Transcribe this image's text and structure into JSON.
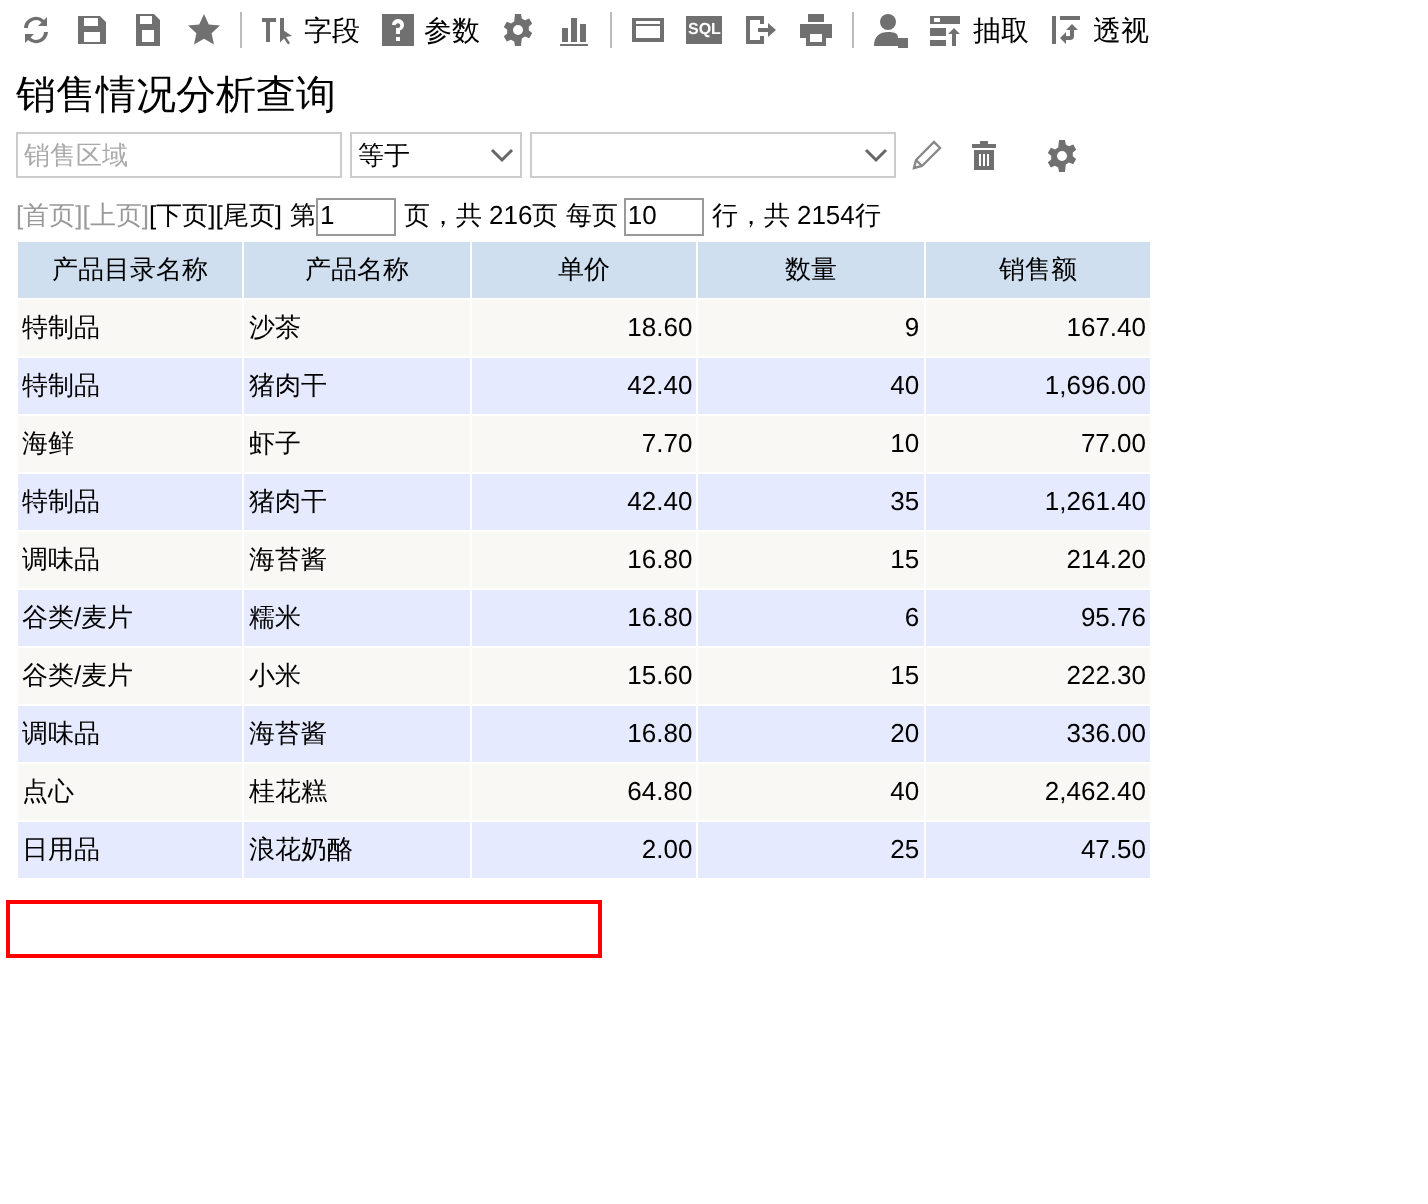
{
  "toolbar": [
    {
      "kind": "icon"
    },
    {
      "kind": "icon"
    },
    {
      "kind": "icon"
    },
    {
      "kind": "icon"
    },
    {
      "kind": "separator"
    },
    {
      "kind": "icon",
      "label": "字段"
    },
    {
      "kind": "icon",
      "label": "参数"
    },
    {
      "kind": "icon"
    },
    {
      "kind": "icon"
    },
    {
      "kind": "separator"
    },
    {
      "kind": "icon"
    },
    {
      "kind": "icon",
      "badge": "SQL"
    },
    {
      "kind": "icon"
    },
    {
      "kind": "icon"
    },
    {
      "kind": "separator"
    },
    {
      "kind": "icon"
    },
    {
      "kind": "icon",
      "label": "抽取"
    },
    {
      "kind": "icon",
      "label": "透视"
    }
  ],
  "title": "销售情况分析查询",
  "filter": {
    "field_placeholder": "销售区域",
    "operator": "等于"
  },
  "pager": {
    "links": [
      {
        "label": "[首页]",
        "disabled": true
      },
      {
        "label": "[上页]",
        "disabled": true
      },
      {
        "label": "[下页]",
        "disabled": false
      },
      {
        "label": "[尾页]",
        "disabled": false
      }
    ],
    "page_prefix": "第",
    "page": "1",
    "page_suffix": "页，共 216页 每页",
    "per_page": "10",
    "total": "行，共 2154行"
  },
  "table": {
    "columns": [
      "产品目录名称",
      "产品名称",
      "单价",
      "数量",
      "销售额"
    ],
    "rows": [
      [
        "特制品",
        "沙茶",
        "18.60",
        "9",
        "167.40"
      ],
      [
        "特制品",
        "猪肉干",
        "42.40",
        "40",
        "1,696.00"
      ],
      [
        "海鲜",
        "虾子",
        "7.70",
        "10",
        "77.00"
      ],
      [
        "特制品",
        "猪肉干",
        "42.40",
        "35",
        "1,261.40"
      ],
      [
        "调味品",
        "海苔酱",
        "16.80",
        "15",
        "214.20"
      ],
      [
        "谷类/麦片",
        "糯米",
        "16.80",
        "6",
        "95.76"
      ],
      [
        "谷类/麦片",
        "小米",
        "15.60",
        "15",
        "222.30"
      ],
      [
        "调味品",
        "海苔酱",
        "16.80",
        "20",
        "336.00"
      ],
      [
        "点心",
        "桂花糕",
        "64.80",
        "40",
        "2,462.40"
      ],
      [
        "日用品",
        "浪花奶酪",
        "2.00",
        "25",
        "47.50"
      ]
    ]
  }
}
